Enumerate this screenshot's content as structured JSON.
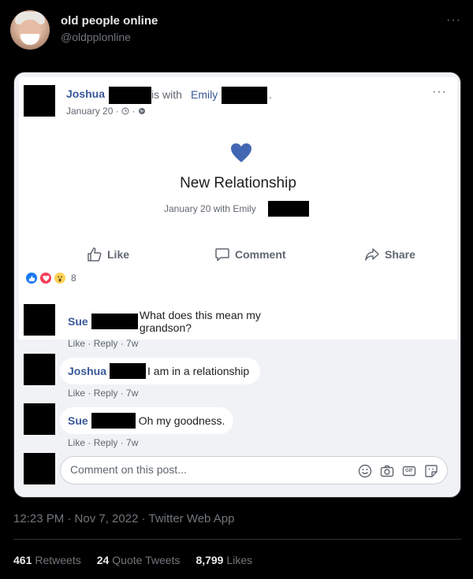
{
  "tweet": {
    "display_name": "old people online",
    "handle": "@oldpplonline",
    "more_glyph": "···",
    "timestamp": "12:23 PM · Nov 7, 2022 · Twitter Web App",
    "stats": [
      {
        "count": "461",
        "label": "Retweets"
      },
      {
        "count": "24",
        "label": "Quote Tweets"
      },
      {
        "count": "8,799",
        "label": "Likes"
      }
    ]
  },
  "fb": {
    "author": "Joshua",
    "with_text": "is with",
    "with_name": "Emily",
    "trailing": ".",
    "date": "January 20 · ",
    "menu_glyph": "···",
    "event_title": "New Relationship",
    "event_sub": "January 20 with Emily",
    "actions": {
      "like": "Like",
      "comment": "Comment",
      "share": "Share"
    },
    "reaction_count": "8",
    "comments": [
      {
        "name": "Sue",
        "text": "What does this mean my grandson?",
        "like": "Like",
        "reply": "Reply",
        "time": "7w"
      },
      {
        "name": "Joshua",
        "text": "I am in a relationship",
        "like": "Like",
        "reply": "Reply",
        "time": "7w"
      },
      {
        "name": "Sue",
        "text": "Oh my goodness.",
        "like": "Like",
        "reply": "Reply",
        "time": "7w"
      }
    ],
    "comment_placeholder": "Comment on this post...",
    "gif_label": "GIF",
    "colors": {
      "fb_blue": "#385898",
      "heart": "#4267b2",
      "panel": "#f0f2f5"
    }
  }
}
